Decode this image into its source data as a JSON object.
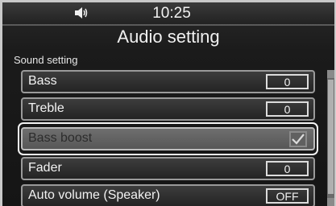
{
  "status": {
    "time": "10:25",
    "volume_icon": "speaker-icon"
  },
  "header": {
    "title": "Audio setting"
  },
  "section": {
    "label": "Sound setting"
  },
  "settings": [
    {
      "label": "Bass",
      "value": "0"
    },
    {
      "label": "Treble",
      "value": "0"
    },
    {
      "label": "Bass boost",
      "checked": true
    },
    {
      "label": "Fader",
      "value": "0"
    },
    {
      "label": "Auto volume (Speaker)",
      "value": "OFF"
    }
  ]
}
